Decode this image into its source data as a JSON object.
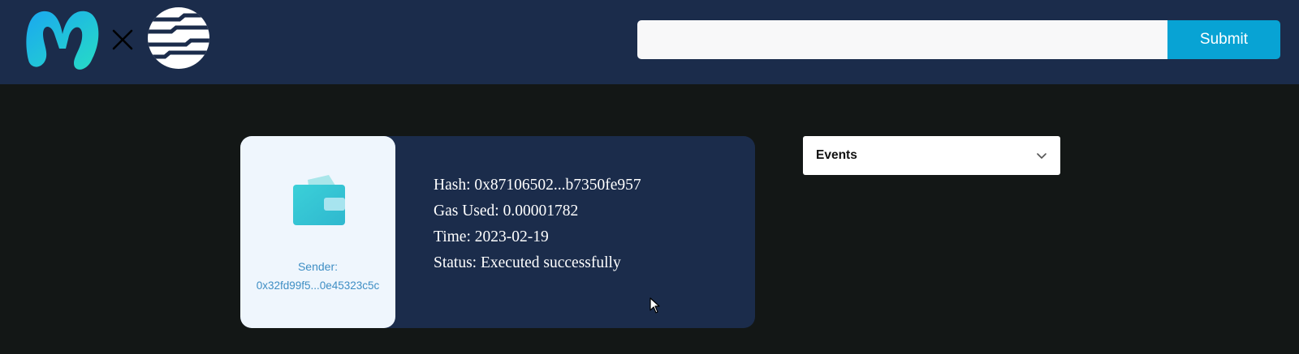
{
  "header": {
    "logo_left_icon": "m-logo-icon",
    "logo_separator_icon": "x-icon",
    "logo_right_icon": "stripes-logo-icon",
    "search": {
      "value": "",
      "placeholder": ""
    },
    "submit_label": "Submit"
  },
  "transaction": {
    "sender_icon": "wallet-icon",
    "sender_label": "Sender:",
    "sender_address": "0x32fd99f5...0e45323c5c",
    "hash": "Hash: 0x87106502...b7350fe957",
    "gas_used": "Gas Used: 0.00001782",
    "time": "Time: 2023-02-19",
    "status": "Status: Executed successfully"
  },
  "events_dropdown": {
    "label": "Events",
    "icon": "chevron-down-icon"
  },
  "colors": {
    "header_bg": "#1b2c4b",
    "page_bg": "#131716",
    "accent": "#08a3d4",
    "sender_text": "#3e8ec4"
  }
}
